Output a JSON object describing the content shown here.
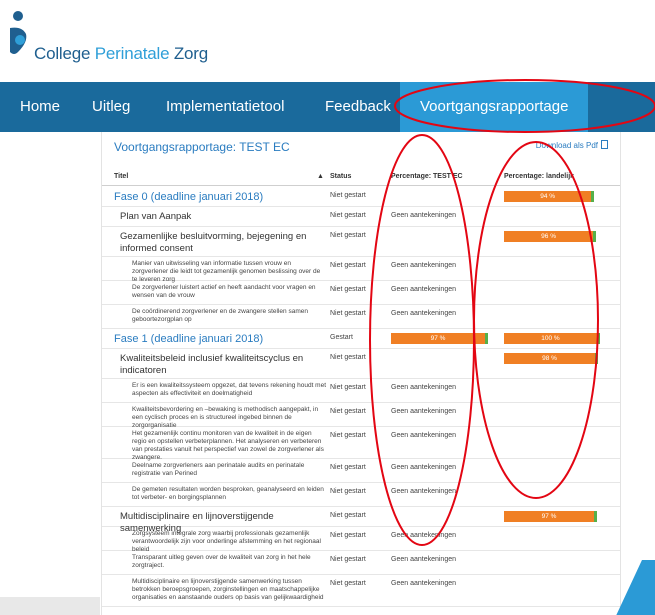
{
  "brand": {
    "name_part1": "College ",
    "name_part2": "Perinatale",
    "name_part3": " Zorg"
  },
  "nav": {
    "items": [
      {
        "label": "Home"
      },
      {
        "label": "Uitleg"
      },
      {
        "label": "Implementatietool"
      },
      {
        "label": "Feedback"
      },
      {
        "label": "Voortgangsrapportage",
        "active": true
      }
    ]
  },
  "report": {
    "title": "Voortgangsrapportage: TEST EC",
    "download_label": "Download als Pdf",
    "columns": {
      "title": "Titel",
      "status": "Status",
      "test": "Percentage: TEST EC",
      "national": "Percentage: landelijk"
    },
    "rows": [
      {
        "kind": "fase",
        "title": "Fase 0 (deadline januari 2018)",
        "status": "Niet gestart",
        "test": "",
        "national": "94 %",
        "national_pct": 94
      },
      {
        "kind": "sub",
        "title": "Plan van Aanpak",
        "status": "Niet gestart",
        "test": "Geen aantekeningen",
        "national": ""
      },
      {
        "kind": "sub",
        "title": "Gezamenlijke besluitvorming, bejegening en informed consent",
        "status": "Niet gestart",
        "test": "",
        "national": "96 %",
        "national_pct": 96
      },
      {
        "kind": "item",
        "title": "Manier van uitwisseling van informatie tussen vrouw en zorgverlener die leidt tot gezamenlijk genomen beslissing over de te leveren zorg",
        "status": "Niet gestart",
        "test": "Geen aantekeningen",
        "national": ""
      },
      {
        "kind": "item",
        "title": "De zorgverlener luistert actief en heeft aandacht voor vragen en wensen van de vrouw",
        "status": "Niet gestart",
        "test": "Geen aantekeningen",
        "national": ""
      },
      {
        "kind": "item",
        "title": "De coördinerend zorgverlener en de zwangere stellen samen geboortezorgplan op",
        "status": "Niet gestart",
        "test": "Geen aantekeningen",
        "national": ""
      },
      {
        "kind": "fase",
        "title": "Fase 1 (deadline januari 2018)",
        "status": "Gestart",
        "test": "97 %",
        "test_pct": 97,
        "national": "100 %",
        "national_pct": 100
      },
      {
        "kind": "sub",
        "title": "Kwaliteitsbeleid inclusief kwaliteitscyclus en indicatoren",
        "status": "Niet gestart",
        "test": "",
        "national": "98 %",
        "national_pct": 98
      },
      {
        "kind": "item",
        "title": "Er is een kwaliteitssysteem opgezet, dat tevens rekening houdt met aspecten als effectiviteit en doelmatigheid",
        "status": "Niet gestart",
        "test": "Geen aantekeningen",
        "national": ""
      },
      {
        "kind": "item",
        "title": "Kwaliteitsbevordering en –bewaking is methodisch aangepakt, in een cyclisch proces en is structureel ingebed binnen de zorgorganisatie",
        "status": "Niet gestart",
        "test": "Geen aantekeningen",
        "national": ""
      },
      {
        "kind": "item",
        "title": "Het gezamenlijk continu monitoren van de kwaliteit in de eigen regio en opstellen verbeterplannen. Het analyseren en verbeteren van prestaties vanuit het perspectief van zowel de zorgverlener als zwangere.",
        "status": "Niet gestart",
        "test": "Geen aantekeningen",
        "national": ""
      },
      {
        "kind": "item",
        "title": "Deelname zorgverleners aan perinatale audits en perinatale registratie van Perined",
        "status": "Niet gestart",
        "test": "Geen aantekeningen",
        "national": ""
      },
      {
        "kind": "item",
        "title": "De gemeten resultaten worden besproken, geanalyseerd en leiden tot verbeter- en borgingsplannen",
        "status": "Niet gestart",
        "test": "Geen aantekeningen",
        "national": ""
      },
      {
        "kind": "sub",
        "title": "Multidisciplinaire en lijnoverstijgende samenwerking",
        "status": "Niet gestart",
        "test": "",
        "national": "97 %",
        "national_pct": 97
      },
      {
        "kind": "item",
        "title": "Zorgsysteem integrale zorg waarbij professionals gezamenlijk verantwoordelijk zijn voor onderlinge afstemming en het regionaal beleid",
        "status": "Niet gestart",
        "test": "Geen aantekeningen",
        "national": ""
      },
      {
        "kind": "item",
        "title": "Transparant uitleg geven over de kwaliteit van zorg in het hele zorgtraject.",
        "status": "Niet gestart",
        "test": "Geen aantekeningen",
        "national": ""
      },
      {
        "kind": "item",
        "title": "Multidisciplinaire en lijnoverstijgende samenwerking tussen betrokken beroepsgroepen, zorginstellingen en maatschappelijke organisaties en aanstaande ouders op basis van gelijkwaardigheid",
        "status": "Niet gestart",
        "test": "Geen aantekeningen",
        "national": ""
      }
    ]
  },
  "colors": {
    "nav_bg": "#1a6a9c",
    "nav_active": "#2b9ad6",
    "bar": "#f07f24",
    "bar_end": "#55b04a",
    "annotation": "#e30613"
  }
}
